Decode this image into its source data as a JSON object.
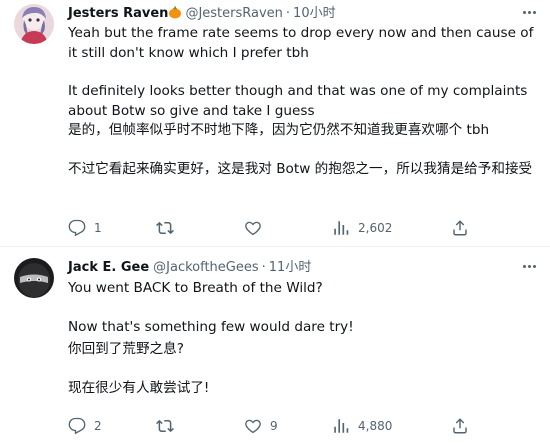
{
  "tweets": [
    {
      "author": {
        "name": "Jesters Raven",
        "handle": "@JestersRaven",
        "emoji_icon": "pumpkin-emoji"
      },
      "separator": "·",
      "time": "10小时",
      "body": [
        "Yeah but the frame rate seems to drop every now and then cause of it still don't know which I prefer tbh",
        "It definitely looks better though and that was one of my complaints about Botw so give and take I guess",
        "是的，但帧率似乎时不时地下降，因为它仍然不知道我更喜欢哪个 tbh",
        "不过它看起来确实更好，这是我对 Botw 的抱怨之一，所以我猜是给予和接受"
      ],
      "stats": {
        "replies": "1",
        "retweets": "",
        "likes": "",
        "views": "2,602"
      }
    },
    {
      "author": {
        "name": "Jack E. Gee",
        "handle": "@JackoftheGees"
      },
      "separator": "·",
      "time": "11小时",
      "body": [
        "You went BACK to Breath of the Wild?",
        "Now that's something few would dare try!",
        "你回到了荒野之息?",
        "现在很少有人敢尝试了!"
      ],
      "stats": {
        "replies": "2",
        "retweets": "",
        "likes": "9",
        "views": "4,880"
      }
    }
  ],
  "icons": {
    "reply": "reply-icon",
    "retweet": "retweet-icon",
    "like": "heart-icon",
    "views": "views-icon",
    "share": "share-icon",
    "more": "more-icon"
  },
  "colors": {
    "text": "#0f1419",
    "secondary": "#536471",
    "separator": "#eff3f4",
    "pumpkin": "#f4900c"
  }
}
